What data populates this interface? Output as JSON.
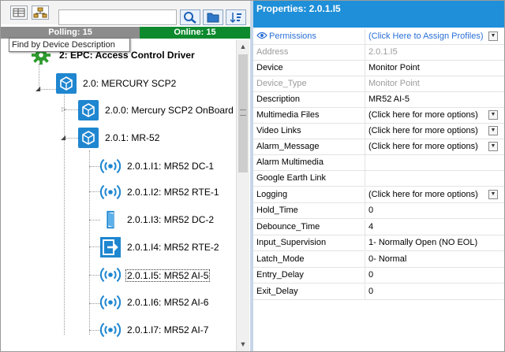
{
  "toolbar": {
    "search_value": "",
    "icons": [
      "grid-view-icon",
      "network-tree-icon",
      "search-icon",
      "folder-icon",
      "sort-icon"
    ]
  },
  "status": {
    "polling": "Polling: 15",
    "online": "Online: 15"
  },
  "tooltip": "Find by Device Description",
  "tree": {
    "nodes": [
      {
        "label": "2:  EPC: Access Control Driver",
        "icon": "gear-icon"
      },
      {
        "label": "2.0:  MERCURY SCP2",
        "icon": "mercury-controller-icon"
      },
      {
        "label": "2.0.0:  Mercury SCP2 OnBoard",
        "icon": "mercury-controller-icon"
      },
      {
        "label": "2.0.1:  MR-52",
        "icon": "mercury-controller-icon"
      },
      {
        "label": "2.0.1.I1:  MR52 DC-1",
        "icon": "wireless-input-icon"
      },
      {
        "label": "2.0.1.I2:  MR52 RTE-1",
        "icon": "wireless-input-icon"
      },
      {
        "label": "2.0.1.I3:  MR52 DC-2",
        "icon": "door-icon"
      },
      {
        "label": "2.0.1.I4:  MR52 RTE-2",
        "icon": "exit-icon"
      },
      {
        "label": "2.0.1.I5:  MR52 AI-5",
        "icon": "wireless-input-icon"
      },
      {
        "label": "2.0.1.I6:  MR52 AI-6",
        "icon": "wireless-input-icon"
      },
      {
        "label": "2.0.1.I7:  MR52 AI-7",
        "icon": "wireless-input-icon"
      }
    ]
  },
  "properties": {
    "title": "Properties:  2.0.1.I5",
    "rows": [
      {
        "name": "Permissions",
        "value": "(Click Here to Assign Profiles)"
      },
      {
        "name": "Address",
        "value": "2.0.1.I5"
      },
      {
        "name": "Device",
        "value": "Monitor Point"
      },
      {
        "name": "Device_Type",
        "value": "Monitor Point"
      },
      {
        "name": "Description",
        "value": "MR52 AI-5"
      },
      {
        "name": "Multimedia Files",
        "value": "(Click here for more options)"
      },
      {
        "name": "Video Links",
        "value": "(Click here for more options)"
      },
      {
        "name": "Alarm_Message",
        "value": "(Click here for more options)"
      },
      {
        "name": "Alarm Multimedia",
        "value": ""
      },
      {
        "name": "Google Earth Link",
        "value": ""
      },
      {
        "name": "Logging",
        "value": "(Click here for more options)"
      },
      {
        "name": "Hold_Time",
        "value": "0"
      },
      {
        "name": "Debounce_Time",
        "value": "4"
      },
      {
        "name": "Input_Supervision",
        "value": "1- Normally Open    (NO EOL)"
      },
      {
        "name": "Latch_Mode",
        "value": "0- Normal"
      },
      {
        "name": "Entry_Delay",
        "value": "0"
      },
      {
        "name": "Exit_Delay",
        "value": "0"
      }
    ]
  },
  "colors": {
    "header_blue": "#1e8fd8",
    "online_green": "#0e8a2e",
    "polling_gray": "#8c8c8c",
    "icon_blue": "#1f86d0",
    "gear_green": "#2e9a2e"
  }
}
